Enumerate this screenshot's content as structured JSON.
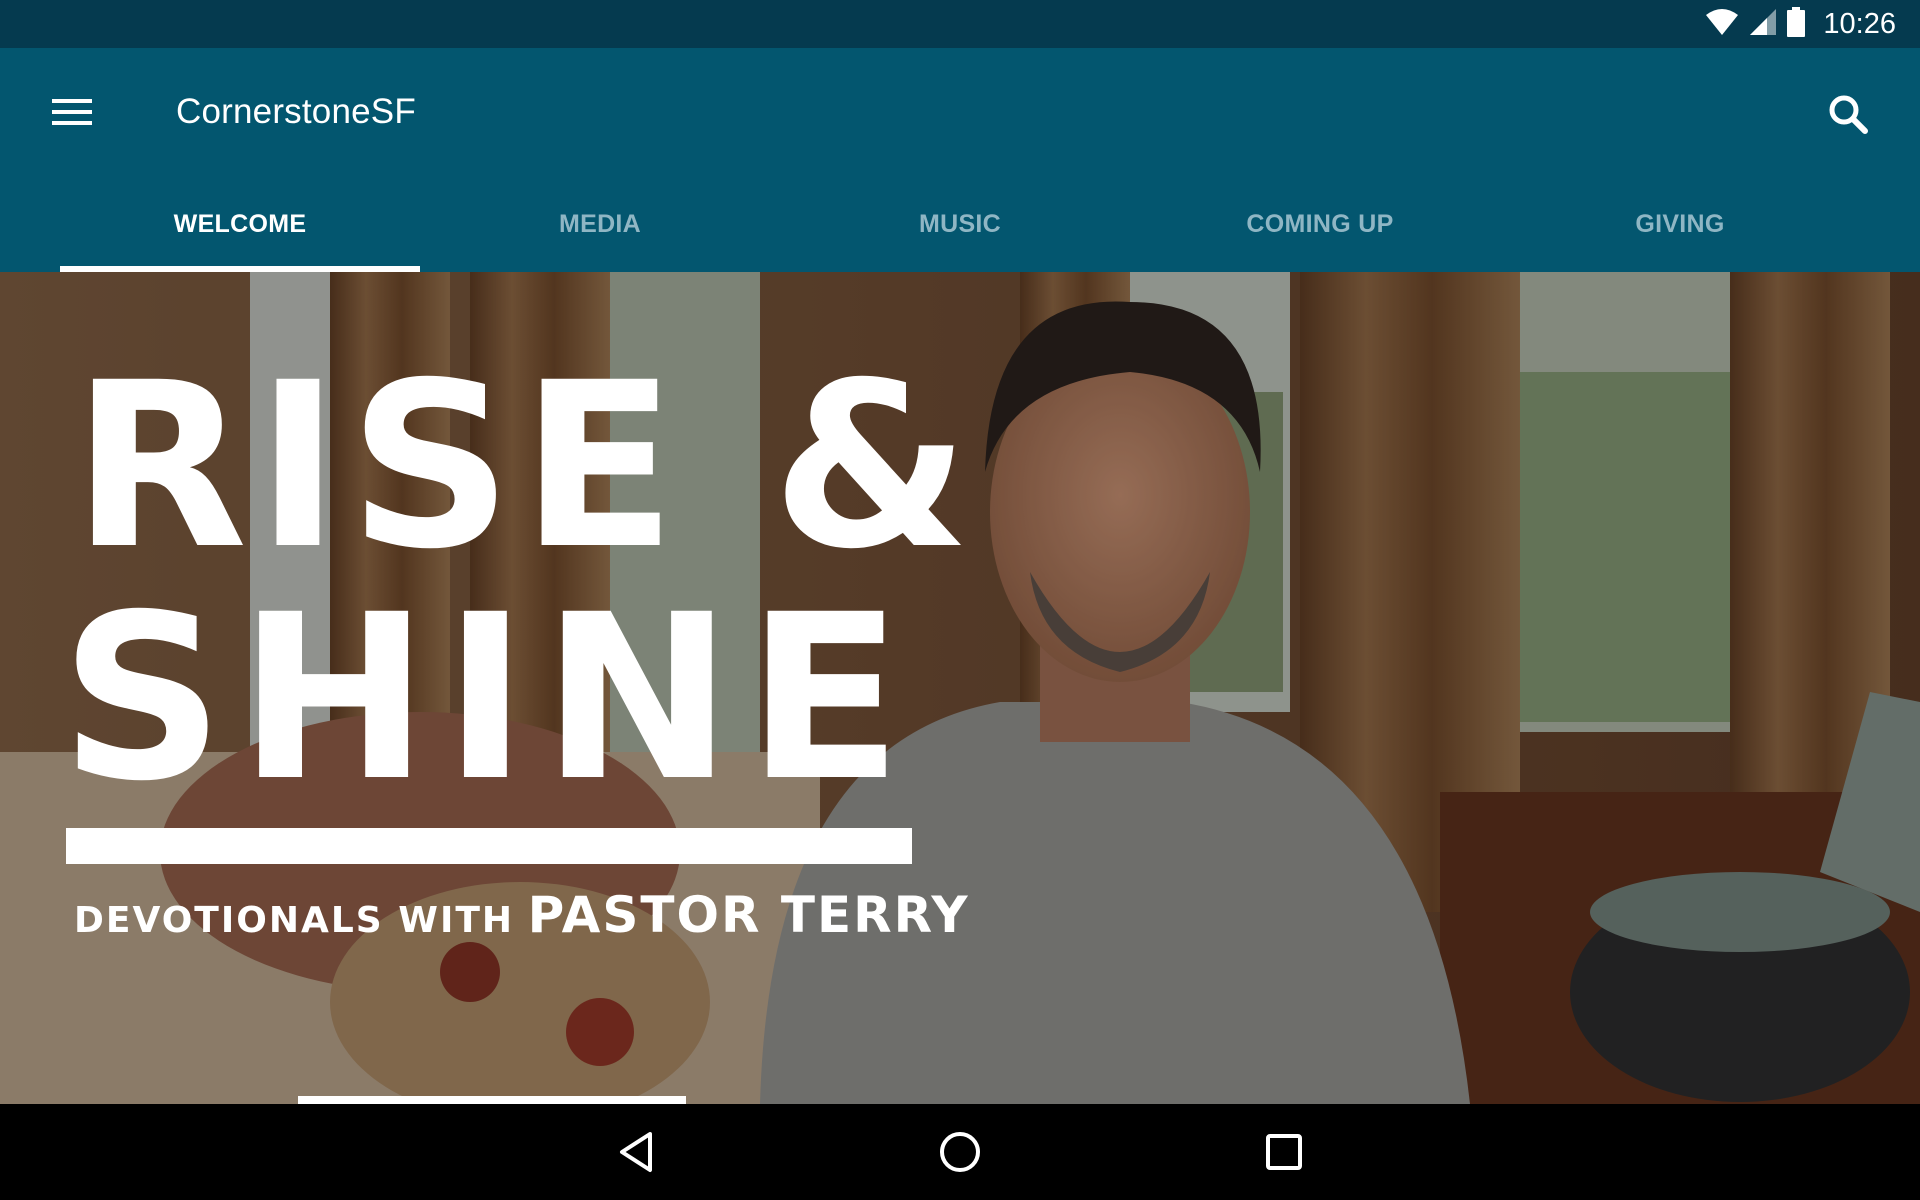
{
  "status_bar": {
    "time": "10:26",
    "icons": [
      "wifi-icon",
      "cell-signal-icon",
      "battery-icon"
    ]
  },
  "app_bar": {
    "title": "CornerstoneSF",
    "menu_icon": "hamburger-menu-icon",
    "search_icon": "search-icon",
    "background": "#03566f"
  },
  "tabs": [
    {
      "label": "WELCOME",
      "active": true
    },
    {
      "label": "MEDIA",
      "active": false
    },
    {
      "label": "MUSIC",
      "active": false
    },
    {
      "label": "COMING UP",
      "active": false
    },
    {
      "label": "GIVING",
      "active": false
    }
  ],
  "hero": {
    "title_line1": "RISE &",
    "title_line2": "SHINE",
    "subtitle_small": "DEVOTIONALS WITH",
    "subtitle_big": "PASTOR TERRY"
  },
  "nav_bar": {
    "buttons": [
      "back-icon",
      "home-icon",
      "recents-icon"
    ]
  }
}
